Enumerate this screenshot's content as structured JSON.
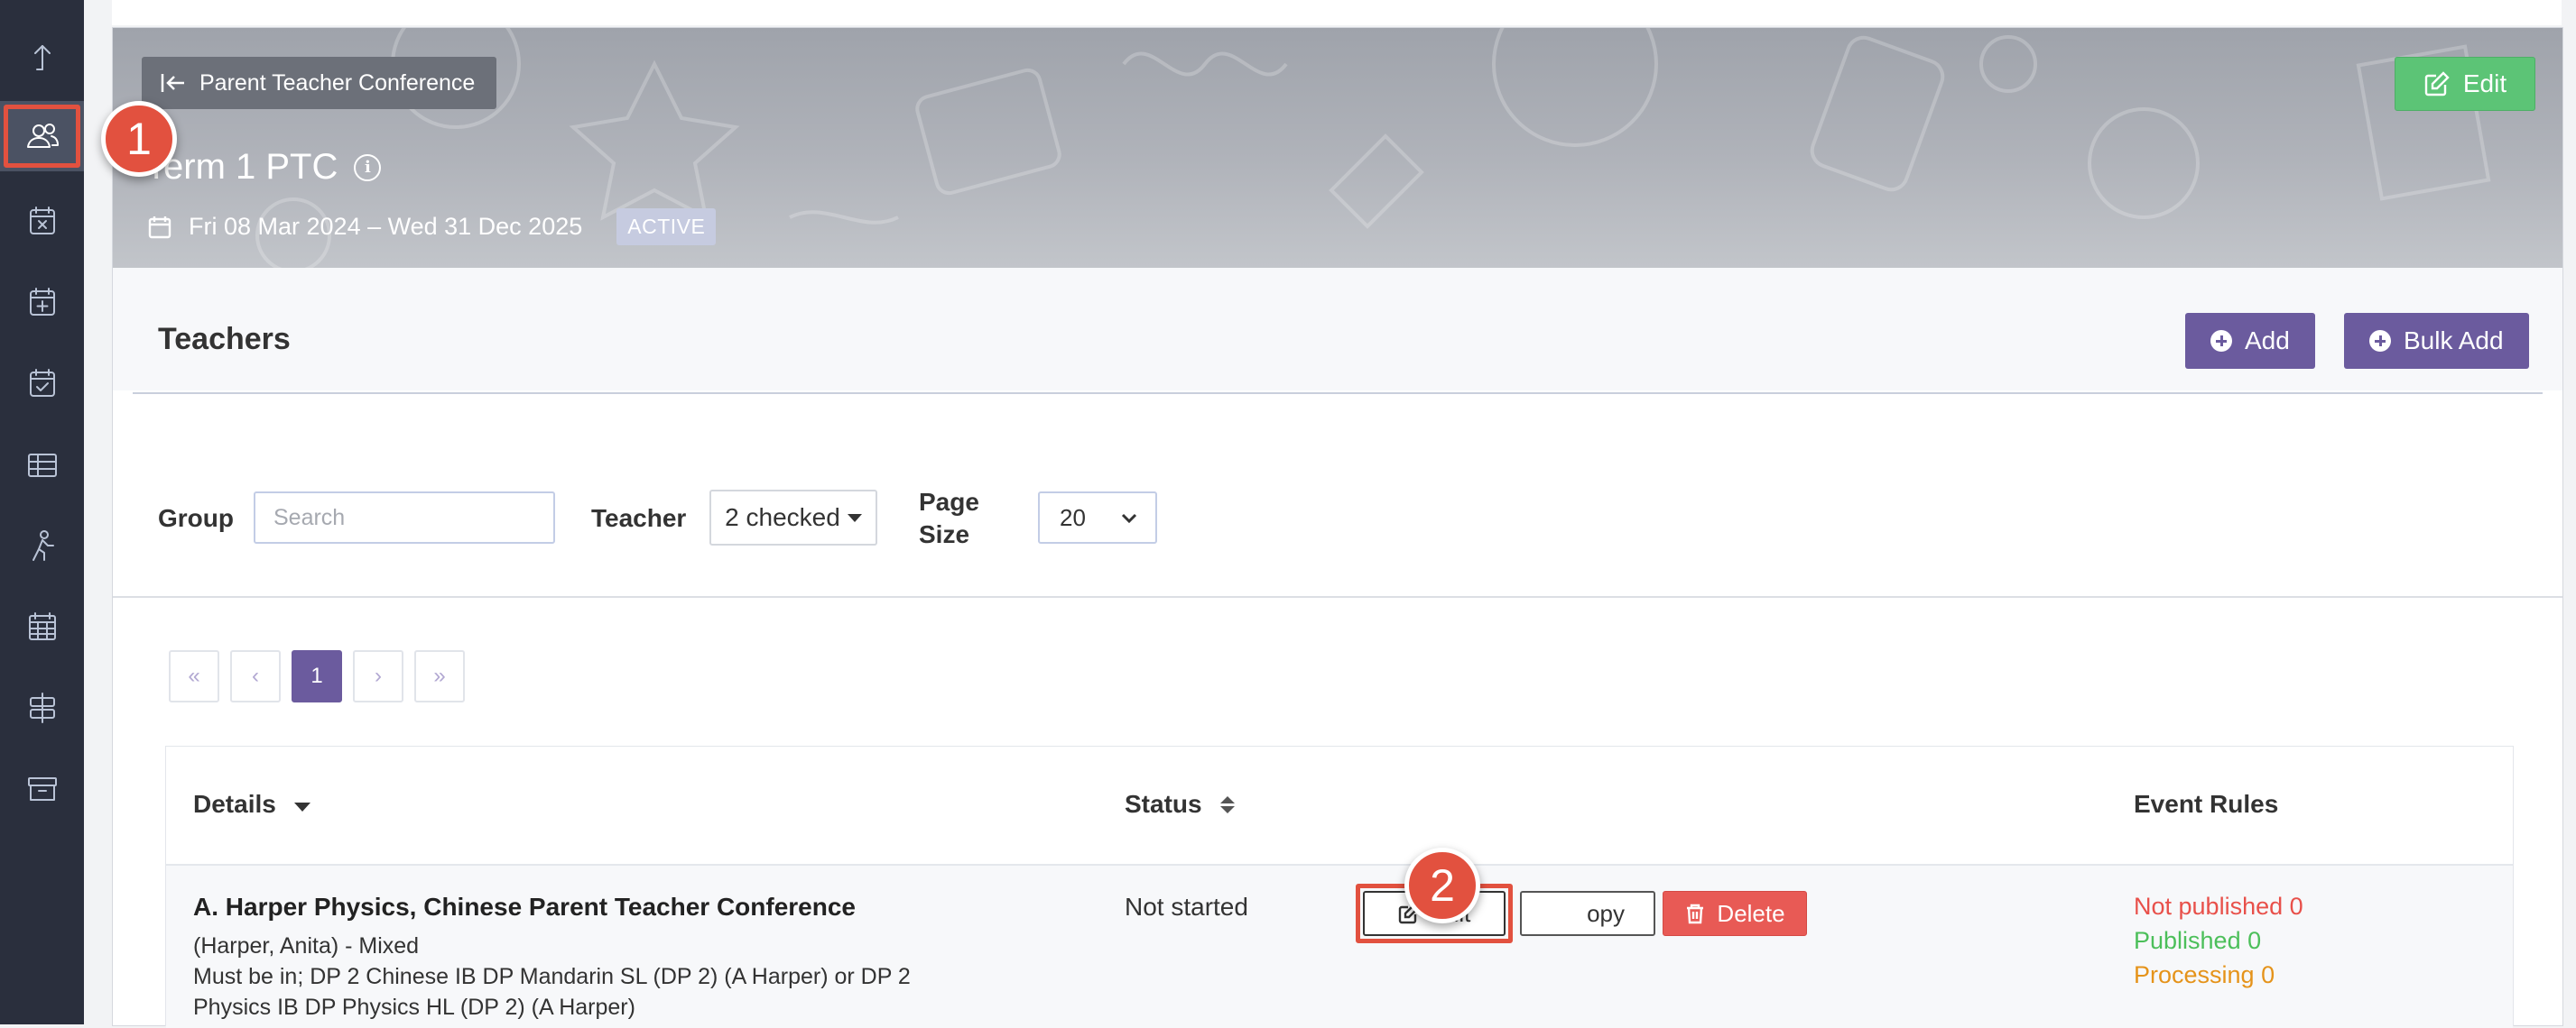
{
  "sidebar": {
    "items": [
      {
        "name": "upload-icon"
      },
      {
        "name": "people-icon",
        "active": true
      },
      {
        "name": "calendar-x-icon"
      },
      {
        "name": "calendar-plus-icon"
      },
      {
        "name": "calendar-check-icon"
      },
      {
        "name": "table-icon"
      },
      {
        "name": "person-walking-icon"
      },
      {
        "name": "calendar-grid-icon"
      },
      {
        "name": "signpost-icon"
      },
      {
        "name": "archive-icon"
      }
    ]
  },
  "steps": {
    "one": "1",
    "two": "2"
  },
  "hero": {
    "back_label": "Parent Teacher Conference",
    "edit_label": "Edit",
    "title": "Term 1 PTC",
    "dates": "Fri 08 Mar 2024 – Wed 31 Dec 2025",
    "status": "ACTIVE"
  },
  "teachers": {
    "title": "Teachers",
    "add_label": "Add",
    "bulk_add_label": "Bulk Add"
  },
  "filters": {
    "group_label": "Group",
    "search_placeholder": "Search",
    "teacher_label": "Teacher",
    "teacher_value": "2 checked",
    "page_size_label_1": "Page",
    "page_size_label_2": "Size",
    "page_size_value": "20"
  },
  "pagination": {
    "first": "«",
    "prev": "‹",
    "current": "1",
    "next": "›",
    "last": "»"
  },
  "table": {
    "columns": {
      "details": "Details",
      "status": "Status",
      "event_rules": "Event Rules"
    },
    "rows": [
      {
        "title": "A. Harper Physics, Chinese Parent Teacher Conference",
        "sub1": "(Harper, Anita) - Mixed",
        "sub2": "Must be in; DP 2 Chinese IB DP Mandarin SL (DP 2) (A Harper) or DP 2",
        "sub3": "Physics IB DP Physics HL (DP 2) (A Harper)",
        "status": "Not started",
        "edit_label": "Edit",
        "copy_label": "opy",
        "delete_label": "Delete",
        "not_published": "Not published 0",
        "published": "Published 0",
        "processing": "Processing 0"
      }
    ]
  },
  "colors": {
    "sidebar": "#2a2f3d",
    "accent_purple": "#6b5b9e",
    "edit_green": "#5cc476",
    "delete_red": "#e85a55",
    "highlight": "#e2513f"
  }
}
